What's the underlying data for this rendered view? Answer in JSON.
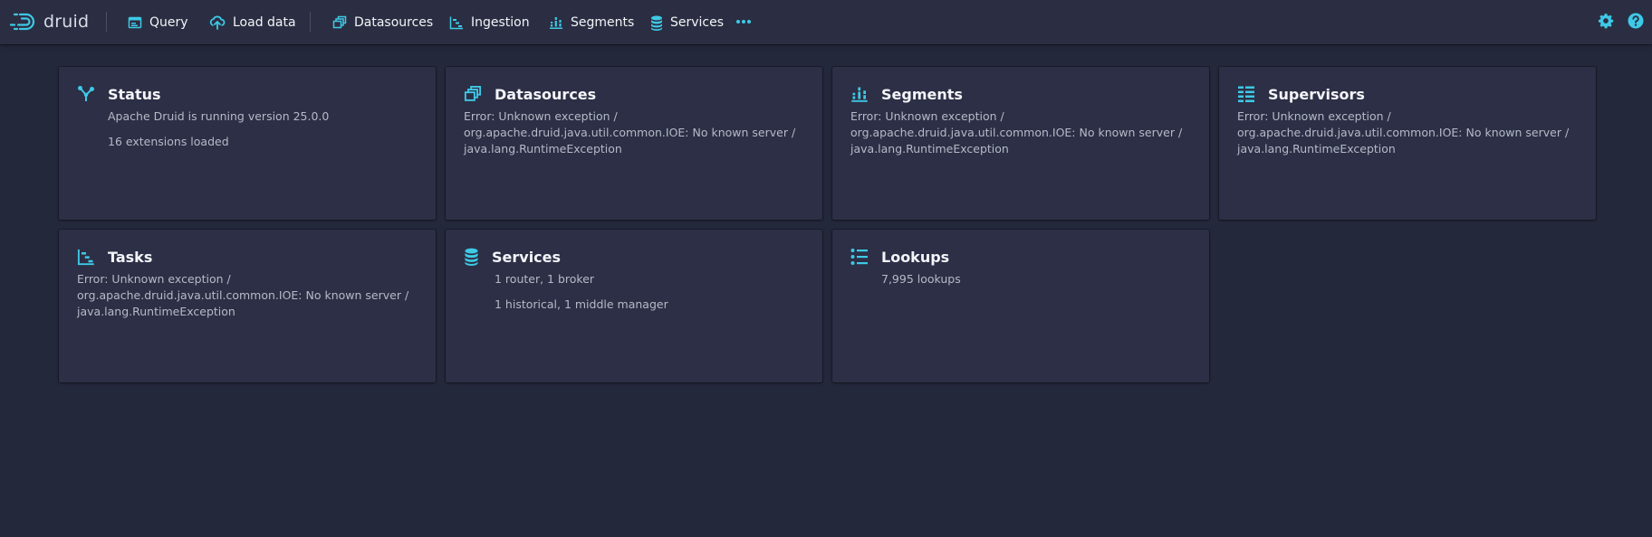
{
  "app": {
    "logo_text": "druid"
  },
  "nav": {
    "query": "Query",
    "load_data": "Load data",
    "datasources": "Datasources",
    "ingestion": "Ingestion",
    "segments": "Segments",
    "services": "Services"
  },
  "icons": {
    "accent_color": "#3ec9e6",
    "more": "more-icon",
    "settings": "gear-icon",
    "help": "help-icon"
  },
  "cards": {
    "status": {
      "title": "Status",
      "line1": "Apache Druid is running version 25.0.0",
      "line2": "16 extensions loaded"
    },
    "datasources": {
      "title": "Datasources",
      "error": "Error: Unknown exception / org.apache.druid.java.util.common.IOE: No known server / java.lang.RuntimeException"
    },
    "segments": {
      "title": "Segments",
      "error": "Error: Unknown exception / org.apache.druid.java.util.common.IOE: No known server / java.lang.RuntimeException"
    },
    "supervisors": {
      "title": "Supervisors",
      "error": "Error: Unknown exception / org.apache.druid.java.util.common.IOE: No known server / java.lang.RuntimeException"
    },
    "tasks": {
      "title": "Tasks",
      "error": "Error: Unknown exception / org.apache.druid.java.util.common.IOE: No known server / java.lang.RuntimeException"
    },
    "services": {
      "title": "Services",
      "line1": "1 router, 1 broker",
      "line2": "1 historical, 1 middle manager"
    },
    "lookups": {
      "title": "Lookups",
      "line1": "7,995 lookups"
    }
  }
}
